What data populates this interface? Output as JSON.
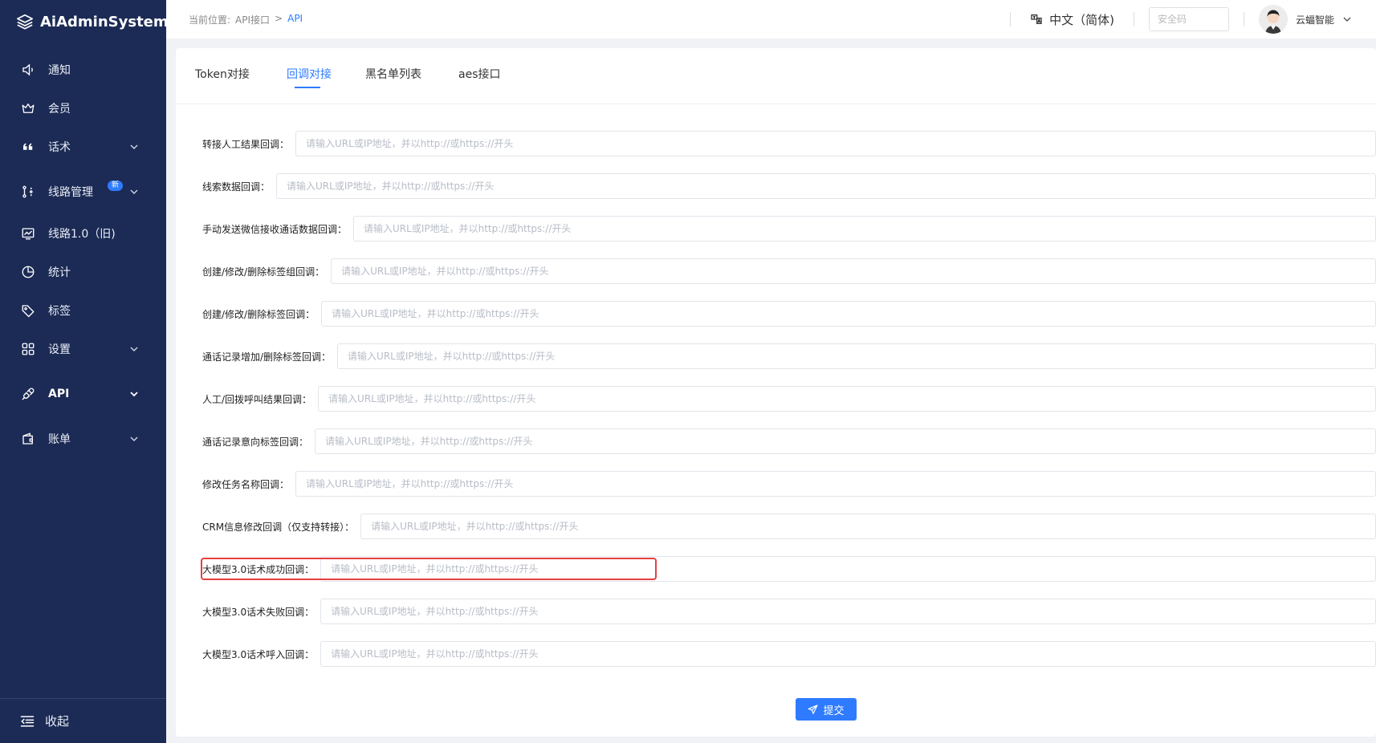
{
  "app": {
    "name": "AiAdminSystem"
  },
  "sidebar": {
    "items": [
      {
        "label": "通知",
        "icon": "speaker-icon"
      },
      {
        "label": "会员",
        "icon": "crown-icon"
      },
      {
        "label": "话术",
        "icon": "quote-icon",
        "has_arrow": true
      },
      {
        "label": "线路管理",
        "icon": "route-icon",
        "has_arrow": true,
        "badge": "新"
      },
      {
        "label": "线路1.0（旧)",
        "icon": "chart-monitor-icon"
      },
      {
        "label": "统计",
        "icon": "pie-chart-icon"
      },
      {
        "label": "标签",
        "icon": "tag-icon"
      },
      {
        "label": "设置",
        "icon": "grid-icon",
        "has_arrow": true
      },
      {
        "label": "API",
        "icon": "plug-icon",
        "has_arrow": true,
        "active": true
      },
      {
        "label": "账单",
        "icon": "wallet-icon",
        "has_arrow": true
      }
    ],
    "collapse_label": "收起"
  },
  "header": {
    "breadcrumb": {
      "prefix": "当前位置:",
      "parent": "API接口",
      "separator": ">",
      "current": "API"
    },
    "language": "中文（简体)",
    "security_placeholder": "安全码",
    "username": "云蝠智能"
  },
  "tabs": [
    {
      "label": "Token对接",
      "active": false
    },
    {
      "label": "回调对接",
      "active": true
    },
    {
      "label": "黑名单列表",
      "active": false
    },
    {
      "label": "aes接口",
      "active": false
    }
  ],
  "form": {
    "placeholder": "请输入URL或IP地址，并以http://或https://开头",
    "fields": [
      {
        "label": "转接人工结果回调："
      },
      {
        "label": "线索数据回调："
      },
      {
        "label": "手动发送微信接收通话数据回调："
      },
      {
        "label": "创建/修改/删除标签组回调："
      },
      {
        "label": "创建/修改/删除标签回调："
      },
      {
        "label": "通话记录增加/删除标签回调："
      },
      {
        "label": "人工/回拨呼叫结果回调："
      },
      {
        "label": "通话记录意向标签回调："
      },
      {
        "label": "修改任务名称回调："
      },
      {
        "label": "CRM信息修改回调（仅支持转接）："
      },
      {
        "label": "大模型3.0话术成功回调："
      },
      {
        "label": "大模型3.0话术失败回调："
      },
      {
        "label": "大模型3.0话术呼入回调："
      }
    ],
    "submit_label": "提交"
  },
  "colors": {
    "sidebar_bg": "#1c2b55",
    "accent": "#2e7bff",
    "highlight": "#e5403f"
  }
}
